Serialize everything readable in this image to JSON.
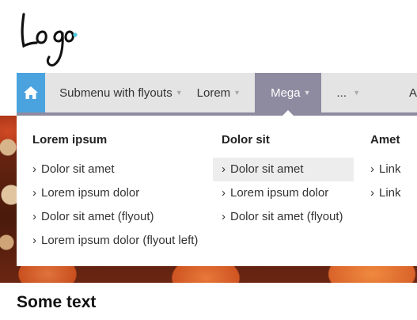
{
  "logo": {
    "text": "Logo",
    "accent": "#4ecbe0"
  },
  "nav": {
    "home_icon": "home-icon",
    "items": [
      {
        "label": "Submenu with flyouts"
      },
      {
        "label": "Lorem"
      },
      {
        "label": "Mega"
      },
      {
        "label": "..."
      },
      {
        "label": "A"
      }
    ],
    "accent": "#4aa3df",
    "active_color": "#8e8aa0"
  },
  "mega": {
    "columns": [
      {
        "heading": "Lorem ipsum",
        "links": [
          "Dolor sit amet",
          "Lorem ipsum dolor",
          "Dolor sit amet (flyout)",
          "Lorem ipsum dolor (flyout left)"
        ]
      },
      {
        "heading": "Dolor sit",
        "links": [
          "Dolor sit amet",
          "Lorem ipsum dolor",
          "Dolor sit amet (flyout)"
        ]
      },
      {
        "heading": "Amet",
        "links": [
          "Link",
          "Link"
        ]
      }
    ]
  },
  "content": {
    "heading": "Some text"
  }
}
